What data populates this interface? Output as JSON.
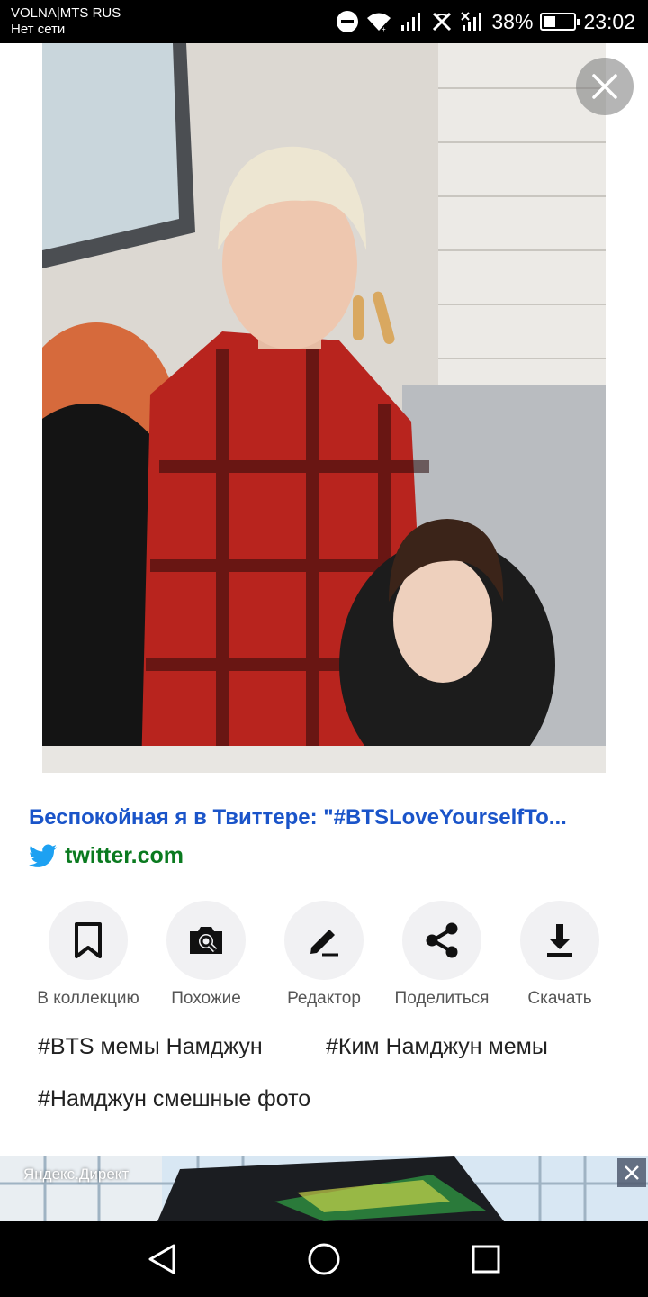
{
  "status_bar": {
    "carrier_line1": "VOLNA|MTS RUS",
    "carrier_line2": "Нет сети",
    "battery": "38%",
    "time": "23:02",
    "icons": [
      "do-not-disturb-icon",
      "wifi-icon",
      "signal-icon",
      "no-signal-icon",
      "signal-icon",
      "battery-icon"
    ]
  },
  "viewer": {
    "close_icon": "close-icon"
  },
  "result": {
    "title": "Беспокойная я в Твиттере: \"#BTSLoveYourselfTo...",
    "source_icon": "twitter-bird-icon",
    "source": "twitter.com",
    "source_color": "#0a7a1f",
    "title_color": "#1a54c9"
  },
  "actions": [
    {
      "icon": "bookmark-icon",
      "label": "В коллекцию"
    },
    {
      "icon": "camera-search-icon",
      "label": "Похожие"
    },
    {
      "icon": "pencil-icon",
      "label": "Редактор"
    },
    {
      "icon": "share-icon",
      "label": "Поделиться"
    },
    {
      "icon": "download-icon",
      "label": "Скачать"
    }
  ],
  "tags": [
    "#BTS мемы Намджун",
    "#Ким Намджун мемы",
    "#Намджун смешные фото"
  ],
  "ad": {
    "label": "Яндекс.Директ",
    "close_icon": "close-icon"
  },
  "nav": {
    "back_icon": "back-triangle-icon",
    "home_icon": "home-circle-icon",
    "recents_icon": "recents-square-icon"
  }
}
